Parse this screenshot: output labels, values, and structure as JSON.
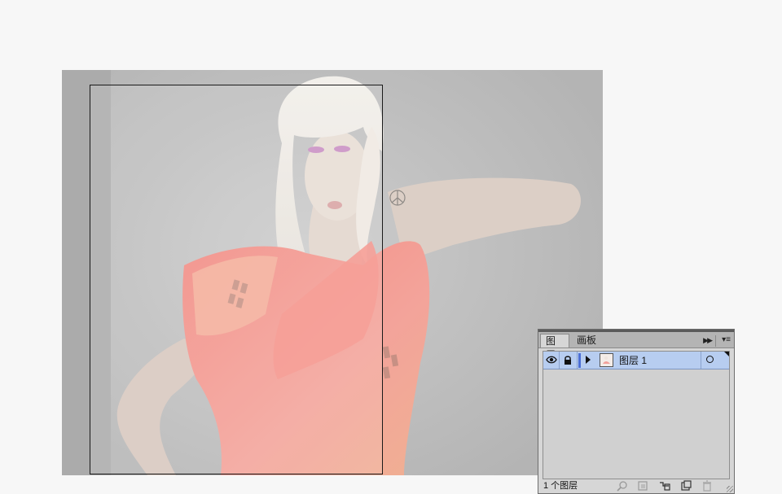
{
  "layers_panel": {
    "tabs": [
      {
        "label": "图层",
        "active": true
      },
      {
        "label": "画板",
        "active": false
      }
    ],
    "collapse_icon": "double-chevron-right-icon",
    "menu_icon": "panel-menu-icon",
    "layers": [
      {
        "name": "图层 1",
        "visible": true,
        "locked": true,
        "color": "#4c6fd6",
        "selected": true
      }
    ],
    "footer": {
      "count_text": "1 个图层",
      "icons": [
        "locate-object-icon",
        "make-clipping-mask-icon",
        "create-sublayer-icon",
        "create-new-layer-icon",
        "delete-icon"
      ]
    }
  },
  "canvas": {
    "background": "#ababab",
    "artboard_border": "#1a1a1a"
  }
}
